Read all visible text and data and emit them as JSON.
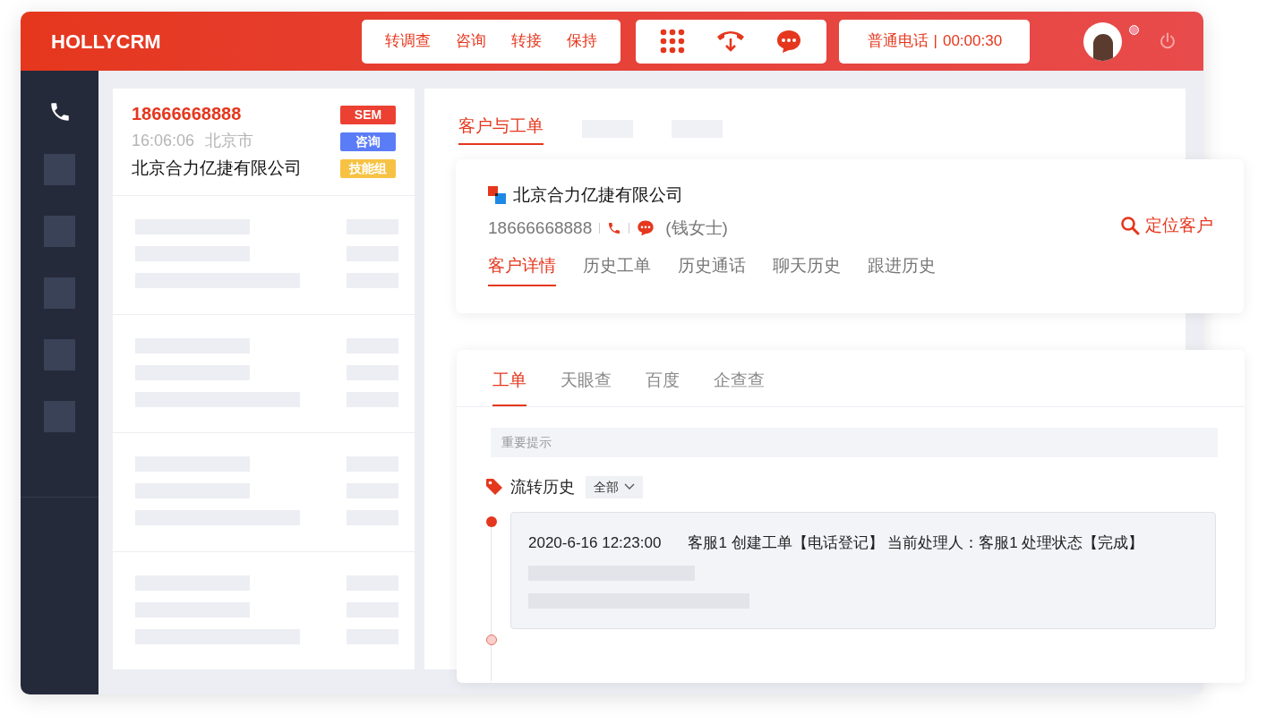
{
  "brand": "HOLLYCRM",
  "call_actions": [
    {
      "label": "转调查"
    },
    {
      "label": "咨询"
    },
    {
      "label": "转接"
    },
    {
      "label": "保持"
    }
  ],
  "call_status": {
    "type": "普通电话",
    "separator": "|",
    "timer": "00:00:30"
  },
  "contact": {
    "phone": "18666668888",
    "time": "16:06:06",
    "city": "北京市",
    "company": "北京合力亿捷有限公司",
    "tags": [
      {
        "label": "SEM",
        "color": "#ec4132"
      },
      {
        "label": "咨询",
        "color": "#5b7cf7"
      },
      {
        "label": "技能组",
        "color": "#f7c244"
      }
    ]
  },
  "main_tabs": [
    {
      "label": "客户与工单",
      "selected": true
    }
  ],
  "customer": {
    "company": "北京合力亿捷有限公司",
    "phone": "18666668888",
    "contact_name": "(钱女士)",
    "locate": "定位客户",
    "tabs": [
      {
        "label": "客户详情",
        "selected": true
      },
      {
        "label": "历史工单",
        "selected": false
      },
      {
        "label": "历史通话",
        "selected": false
      },
      {
        "label": "聊天历史",
        "selected": false
      },
      {
        "label": "跟进历史",
        "selected": false
      }
    ]
  },
  "ticket": {
    "tabs": [
      {
        "label": "工单",
        "selected": true
      },
      {
        "label": "天眼查",
        "selected": false
      },
      {
        "label": "百度",
        "selected": false
      },
      {
        "label": "企查查",
        "selected": false
      }
    ],
    "notice_placeholder": "重要提示",
    "history_label": "流转历史",
    "filter": "全部",
    "entries": [
      {
        "time": "2020-6-16 12:23:00",
        "text": "客服1 创建工单【电话登记】 当前处理人：客服1 处理状态【完成】"
      }
    ]
  }
}
